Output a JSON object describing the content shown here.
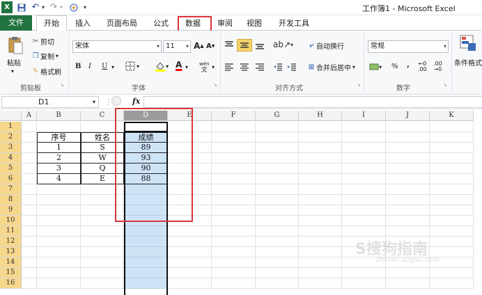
{
  "window": {
    "title": "工作簿1 - Microsoft Excel"
  },
  "quick_access": {
    "undo": "↶",
    "redo": "↷",
    "dropdown": "▾"
  },
  "tabs": [
    {
      "label": "文件"
    },
    {
      "label": "开始"
    },
    {
      "label": "插入"
    },
    {
      "label": "页面布局"
    },
    {
      "label": "公式"
    },
    {
      "label": "数据"
    },
    {
      "label": "审阅"
    },
    {
      "label": "视图"
    },
    {
      "label": "开发工具"
    }
  ],
  "ribbon": {
    "clipboard": {
      "paste": "粘贴",
      "cut": "剪切",
      "copy": "复制",
      "format_painter": "格式刷",
      "group": "剪贴板"
    },
    "font": {
      "name": "宋体",
      "size": "11",
      "grow": "A",
      "shrink": "A",
      "bold": "B",
      "italic": "I",
      "underline": "U",
      "phonetic": "wén",
      "group": "字体"
    },
    "alignment": {
      "wrap": "自动换行",
      "merge": "合并后居中",
      "group": "对齐方式"
    },
    "number": {
      "format": "常规",
      "percent": "%",
      "comma": ",",
      "inc": ".00",
      "dec": ".00",
      "group": "数字"
    },
    "styles": {
      "conditional": "条件格式"
    }
  },
  "formula_bar": {
    "name_box": "D1",
    "fx": "fx",
    "value": ""
  },
  "columns": [
    "A",
    "B",
    "C",
    "D",
    "E",
    "F",
    "G",
    "H",
    "I",
    "J",
    "K"
  ],
  "rows": [
    "1",
    "2",
    "3",
    "4",
    "5",
    "6",
    "7",
    "8",
    "9",
    "10",
    "11",
    "12",
    "13",
    "14",
    "15",
    "16"
  ],
  "table": {
    "headers": [
      "序号",
      "姓名",
      "成绩"
    ],
    "rows": [
      [
        "1",
        "S",
        "89"
      ],
      [
        "2",
        "W",
        "93"
      ],
      [
        "3",
        "Q",
        "90"
      ],
      [
        "4",
        "E",
        "88"
      ]
    ]
  },
  "colors": {
    "accent": "#21733f",
    "highlight": "#d9363a",
    "selection": "#cfe3f7"
  },
  "watermark": {
    "text": "S搜狗指南",
    "sub": "zhinan.sogou.com"
  }
}
